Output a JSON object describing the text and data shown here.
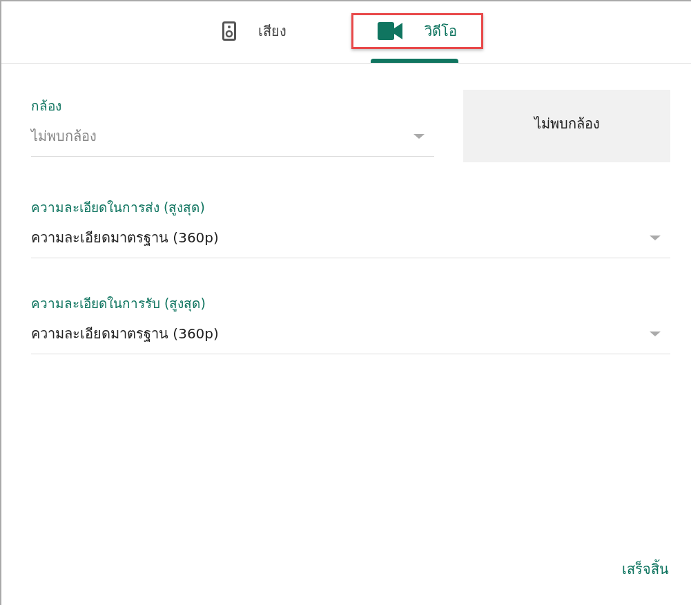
{
  "tabs": [
    {
      "label": "เสียง",
      "kind": "speaker",
      "selected": false,
      "highlighted": false
    },
    {
      "label": "วิดีโอ",
      "kind": "camera",
      "selected": true,
      "highlighted": true
    }
  ],
  "camera": {
    "label": "กล้อง",
    "value": "ไม่พบกล้อง",
    "disabled": true,
    "preview": "ไม่พบกล้อง"
  },
  "resolutions": [
    {
      "label": "ความละเอียดในการส่ง (สูงสุด)",
      "value": "ความละเอียดมาตรฐาน (360p)",
      "disabled": false
    },
    {
      "label": "ความละเอียดในการรับ (สูงสุด)",
      "value": "ความละเอียดมาตรฐาน (360p)",
      "disabled": false
    }
  ],
  "done_button": "เสร็จสิ้น"
}
